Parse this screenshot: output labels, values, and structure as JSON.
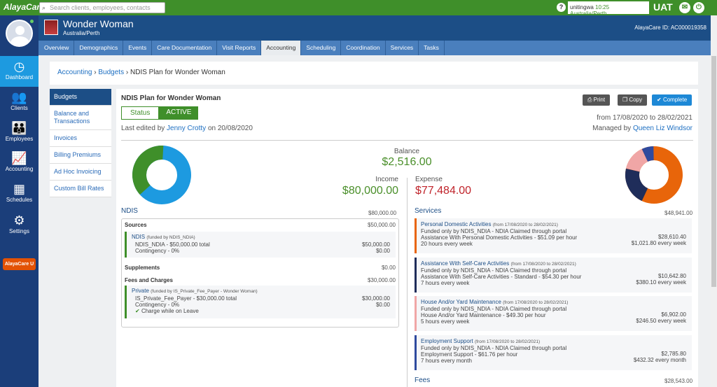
{
  "app": {
    "logo": "AlayaCare",
    "search_placeholder": "Search clients, employees, contacts",
    "help": "?",
    "user": "unitingwa",
    "time": "10:25 Australia/Perth",
    "env": "UAT"
  },
  "sidebar": {
    "items": [
      {
        "label": "Dashboard",
        "icon": "dashboard-icon"
      },
      {
        "label": "Clients",
        "icon": "clients-icon"
      },
      {
        "label": "Employees",
        "icon": "employees-icon"
      },
      {
        "label": "Accounting",
        "icon": "accounting-icon"
      },
      {
        "label": "Schedules",
        "icon": "calendar-icon"
      },
      {
        "label": "Settings",
        "icon": "gear-icon"
      }
    ],
    "university": "AlayaCare U"
  },
  "client": {
    "name": "Wonder Woman",
    "location": "Australia/Perth",
    "id_label": "AlayaCare ID: AC000019358"
  },
  "tabs": [
    "Overview",
    "Demographics",
    "Events",
    "Care Documentation",
    "Visit Reports",
    "Accounting",
    "Scheduling",
    "Coordination",
    "Services",
    "Tasks"
  ],
  "breadcrumb": {
    "a": "Accounting",
    "b": "Budgets",
    "current": "NDIS Plan for Wonder Woman",
    "sep": "›"
  },
  "submenu": [
    "Budgets",
    "Balance and Transactions",
    "Invoices",
    "Billing Premiums",
    "Ad Hoc Invoicing",
    "Custom Bill Rates"
  ],
  "plan": {
    "title": "NDIS Plan for Wonder Woman",
    "status_label": "Status",
    "status_value": "ACTIVE",
    "edited_prefix": "Last edited by",
    "edited_by": "Jenny Crotty",
    "edited_on": "on 20/08/2020",
    "print": "Print",
    "copy": "Copy",
    "complete": "Complete",
    "dates": "from 17/08/2020 to 28/02/2021",
    "managed_prefix": "Managed by",
    "managed_by": "Queen Liz Windsor",
    "balance_label": "Balance",
    "balance": "$2,516.00",
    "income_label": "Income",
    "income": "$80,000.00",
    "expense_label": "Expense",
    "expense": "$77,484.00"
  },
  "ndis": {
    "title": "NDIS",
    "amount": "$80,000.00",
    "sources": "Sources",
    "sources_amt": "$50,000.00",
    "ndis_fund": "NDIS",
    "ndis_fund_note": "(funded by NDIS_NDIA)",
    "ndis_line1": "NDIS_NDIA - $50,000.00 total",
    "ndis_line1_amt": "$50,000.00",
    "ndis_line2": "Contingency - 0%",
    "ndis_line2_amt": "$0.00",
    "supplements": "Supplements",
    "supplements_amt": "$0.00",
    "fees": "Fees and Charges",
    "fees_amt": "$30,000.00",
    "private": "Private",
    "private_note": "(funded by IS_Private_Fee_Payer - Wonder Woman)",
    "private_line1": "IS_Private_Fee_Payer - $30,000.00 total",
    "private_line1_amt": "$30,000.00",
    "private_line2": "Contingency - 0%",
    "private_line2_amt": "$0.00",
    "private_line3": "Charge while on Leave"
  },
  "services": {
    "title": "Services",
    "amount": "$48,941.00",
    "items": [
      {
        "name": "Personal Domestic Activities",
        "range": "(from 17/08/2020 to 28/02/2021)",
        "line1": "Funded only by NDIS_NDIA - NDIA Claimed through portal",
        "line2": "Assistance With Personal Domestic Activities - $51.09 per hour",
        "amt2": "$28,610.40",
        "line3": "20 hours every week",
        "amt3": "$1,021.80 every week",
        "color": "#e8650a"
      },
      {
        "name": "Assistance With Self-Care Activities",
        "range": "(from 17/08/2020 to 28/02/2021)",
        "line1": "Funded only by NDIS_NDIA - NDIA Claimed through portal",
        "line2": "Assistance With Self-Care Activities - Standard - $54.30 per hour",
        "amt2": "$10,642.80",
        "line3": "7 hours every week",
        "amt3": "$380.10 every week",
        "color": "#1f2d5a"
      },
      {
        "name": "House And/or Yard Maintenance",
        "range": "(from 17/08/2020 to 28/02/2021)",
        "line1": "Funded only by NDIS_NDIA - NDIA Claimed through portal",
        "line2": "House And/or Yard Maintenance - $49.30 per hour",
        "amt2": "$6,902.00",
        "line3": "5 hours every week",
        "amt3": "$246.50 every week",
        "color": "#f0a6a6"
      },
      {
        "name": "Employment Support",
        "range": "(from 17/08/2020 to 28/02/2021)",
        "line1": "Funded only by NDIS_NDIA - NDIA Claimed through portal",
        "line2": "Employment Support - $61.76 per hour",
        "amt2": "$2,785.80",
        "line3": "7 hours every month",
        "amt3": "$432.32 every month",
        "color": "#2f4a9e"
      }
    ]
  },
  "fees": {
    "title": "Fees",
    "amount": "$28,543.00"
  },
  "colors": {
    "green": "#3f8f2a",
    "navy": "#1c4e86",
    "blue": "#1d9ae0",
    "orange": "#e8650a"
  }
}
